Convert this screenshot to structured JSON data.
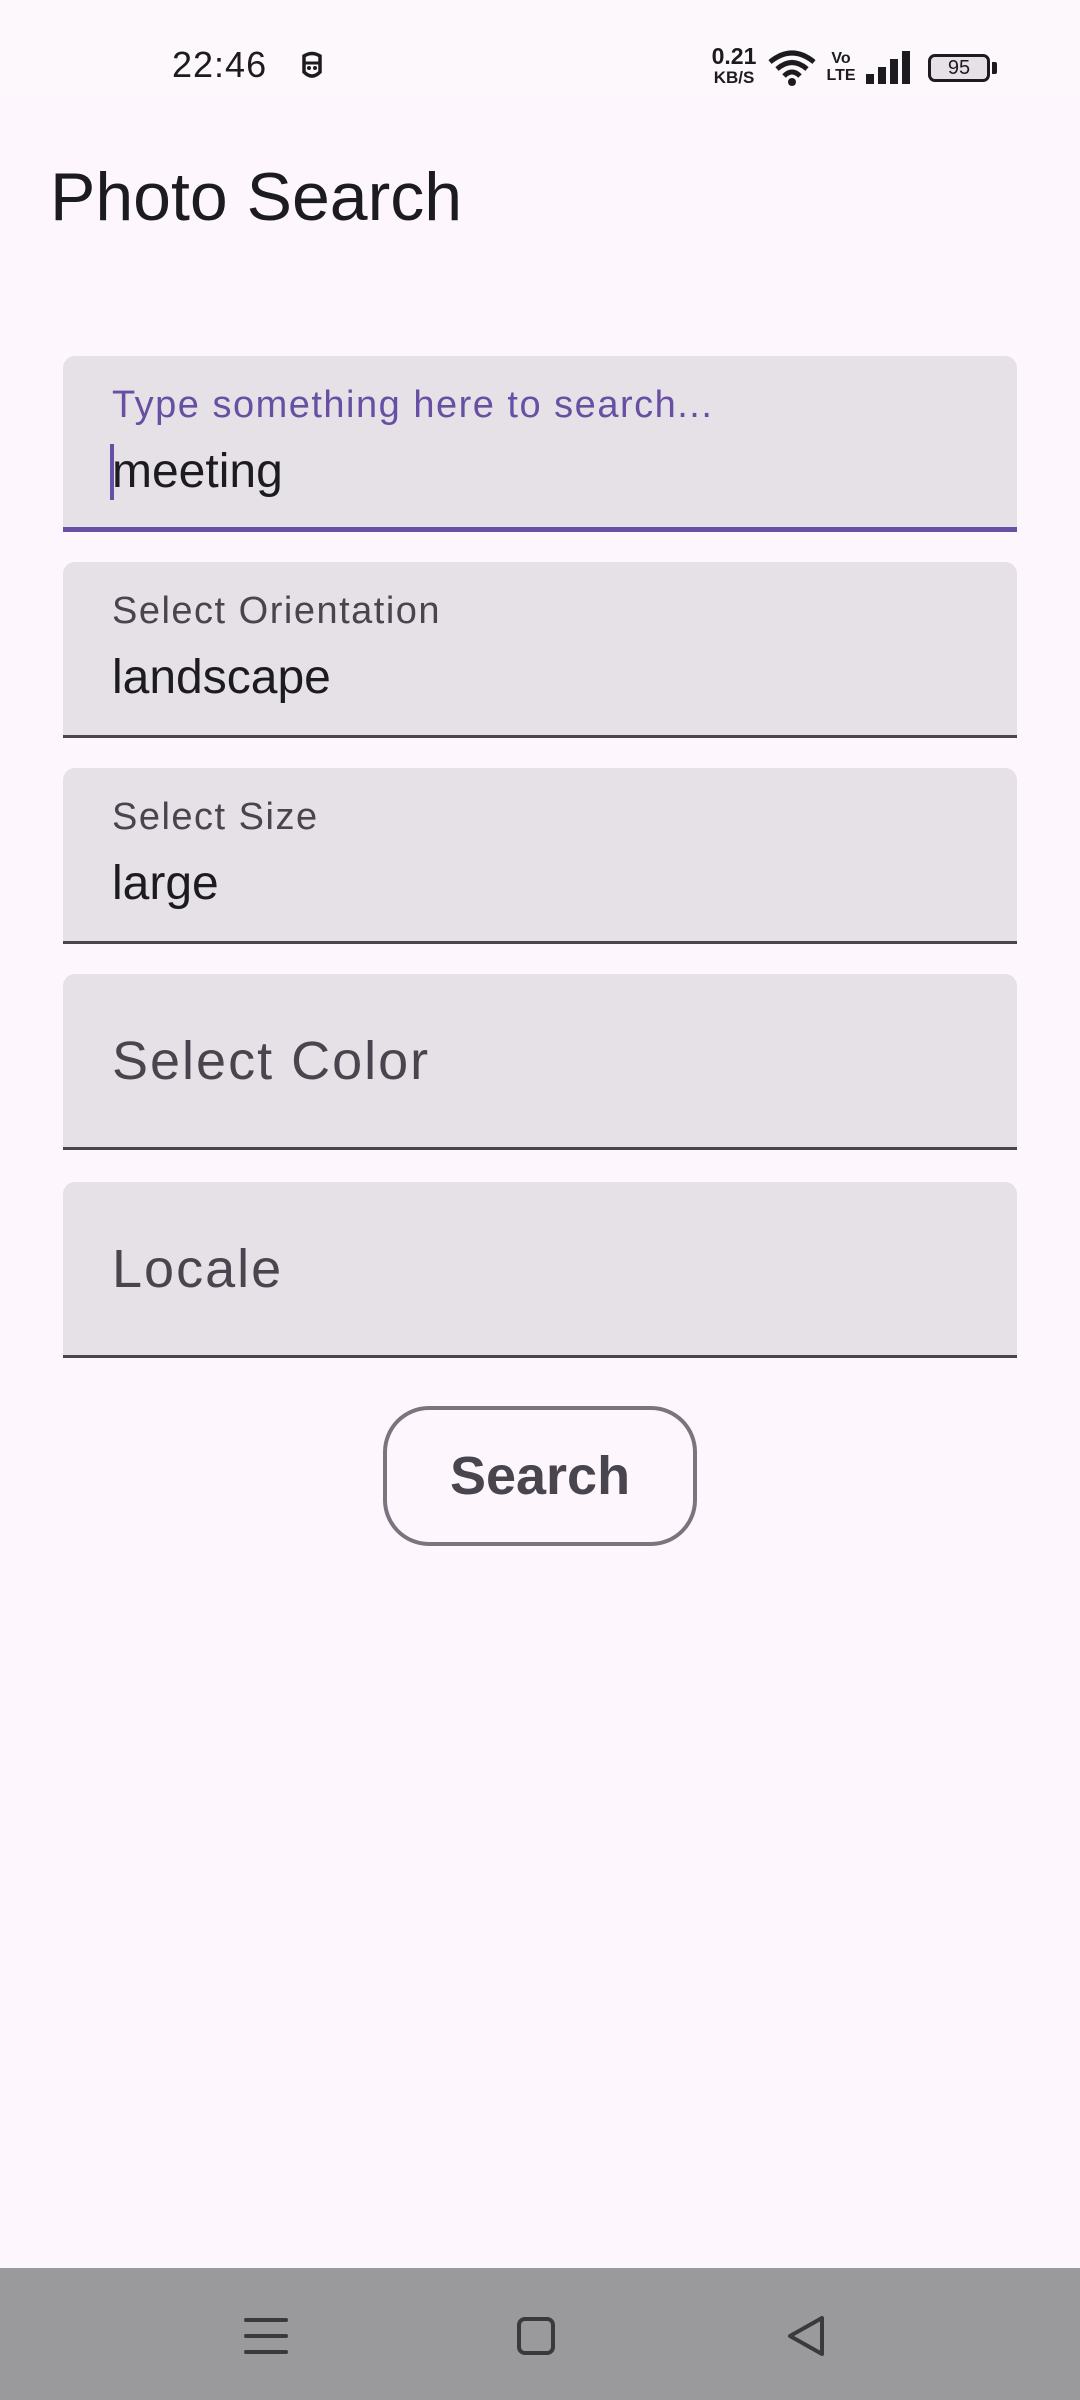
{
  "status_bar": {
    "time": "22:46",
    "net_speed_value": "0.21",
    "net_speed_unit": "KB/S",
    "volte_top": "Vo",
    "volte_bottom": "LTE",
    "battery_level": "95",
    "icons": [
      "notification-icon",
      "wifi-icon",
      "volte-icon",
      "signal-icon",
      "battery-icon"
    ]
  },
  "app": {
    "title": "Photo Search"
  },
  "form": {
    "search": {
      "label": "Type something here to search...",
      "value": "meeting"
    },
    "orientation": {
      "label": "Select Orientation",
      "value": "landscape"
    },
    "size": {
      "label": "Select Size",
      "value": "large"
    },
    "color": {
      "label": "Select Color",
      "value": ""
    },
    "locale": {
      "label": "Locale",
      "value": ""
    },
    "search_button_label": "Search"
  },
  "nav_bar": {
    "icons": [
      "menu-icon",
      "home-icon",
      "back-icon"
    ]
  },
  "colors": {
    "accent": "#6750A4",
    "background": "#FDF7FD",
    "field_fill": "#E6E1E6",
    "nav_bar": "#9A999B"
  }
}
